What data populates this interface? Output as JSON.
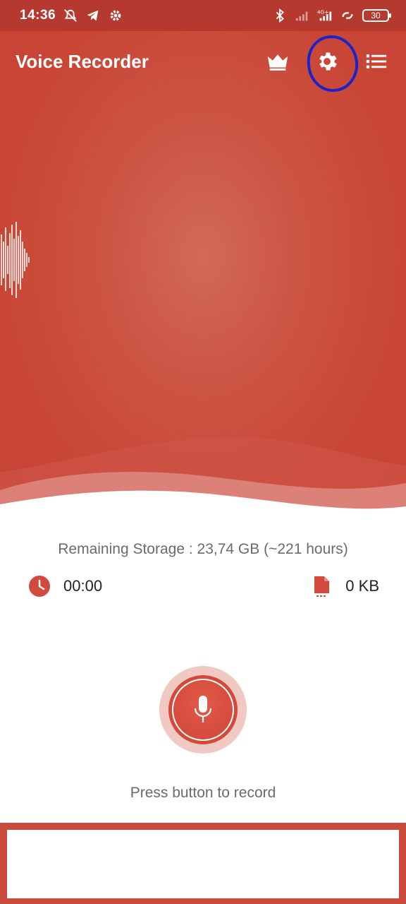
{
  "status_bar": {
    "time": "14:36",
    "battery": "30",
    "icons": [
      "mute-icon",
      "telegram-icon",
      "settings-small-icon",
      "bluetooth-icon",
      "signal-icon",
      "4g-signal-icon",
      "sync-icon",
      "battery-icon"
    ]
  },
  "app_bar": {
    "title": "Voice Recorder",
    "actions": [
      "crown-icon",
      "gear-icon",
      "list-icon"
    ]
  },
  "storage": {
    "text": "Remaining Storage : 23,74 GB (~221 hours)"
  },
  "stats": {
    "duration": "00:00",
    "size": "0 KB"
  },
  "record": {
    "hint": "Press button to record"
  },
  "colors": {
    "primary": "#c94636",
    "status_bar": "#b5392e",
    "highlight": "#1a24c9"
  }
}
